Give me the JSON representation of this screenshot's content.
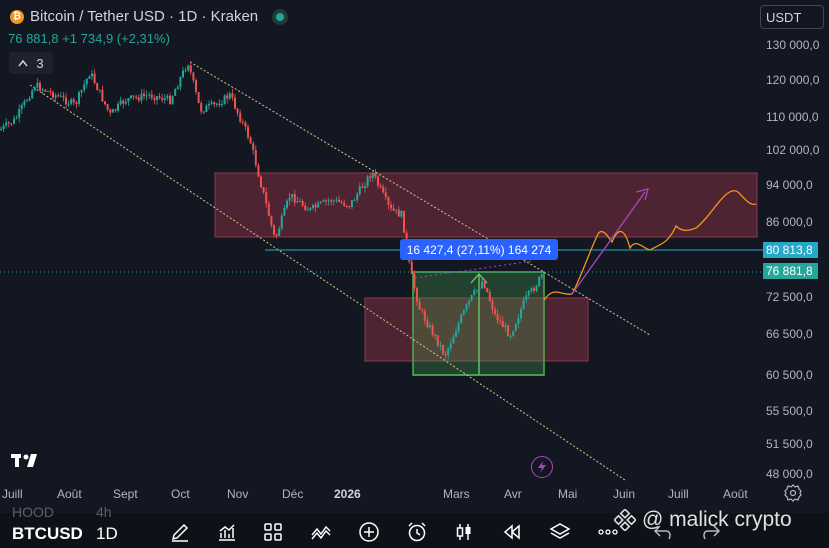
{
  "header": {
    "symbol_title": "Bitcoin / Tether USD · 1D · Kraken",
    "coin_glyph": "₿",
    "price_summary": "76 881,8  +1 734,9 (+2,31%)",
    "collapse_count": "3",
    "currency": "USDT"
  },
  "price_axis": {
    "labels": [
      "130 000,0",
      "120 000,0",
      "110 000,0",
      "102 000,0",
      "94 000,0",
      "86 000,0",
      "72 500,0",
      "66 500,0",
      "60 500,0",
      "55 500,0",
      "51 500,0",
      "48 000,0"
    ],
    "tag_upper": "80 813,8",
    "tag_current": "76 881,8",
    "tag_upper_color": "#26a8c6",
    "tag_current_color": "#26a69a"
  },
  "time_axis": {
    "labels": [
      "Juill",
      "Août",
      "Sept",
      "Oct",
      "Nov",
      "Déc",
      "2026",
      "Mars",
      "Avr",
      "Mai",
      "Juin",
      "Juill",
      "Août"
    ]
  },
  "measure": {
    "label": "16 427,4 (27,11%) 164 274"
  },
  "bottom_bar": {
    "symbol": "BTCUSD",
    "interval": "1D",
    "ghost_symbol": "HOOD",
    "ghost_interval": "4h",
    "watermark": "@ malick crypto"
  },
  "icons": [
    "bitcoin-icon",
    "live-status-icon",
    "chevron-up-icon",
    "chevron-down-icon",
    "tradingview-logo-icon",
    "lightning-icon",
    "gear-icon",
    "pencil-icon",
    "indicators-icon",
    "layout-grid-icon",
    "patterns-icon",
    "add-icon",
    "alarm-icon",
    "candles-icon",
    "replay-icon",
    "layers-icon",
    "more-icon",
    "binance-icon",
    "undo-icon",
    "redo-icon"
  ],
  "colors": {
    "background": "#131722",
    "accent": "#2962ff",
    "up": "#26a69a",
    "down": "#ef5350",
    "zone": "#7b2b3f",
    "projection": "#f7931a",
    "arrow": "#ab47bc"
  }
}
